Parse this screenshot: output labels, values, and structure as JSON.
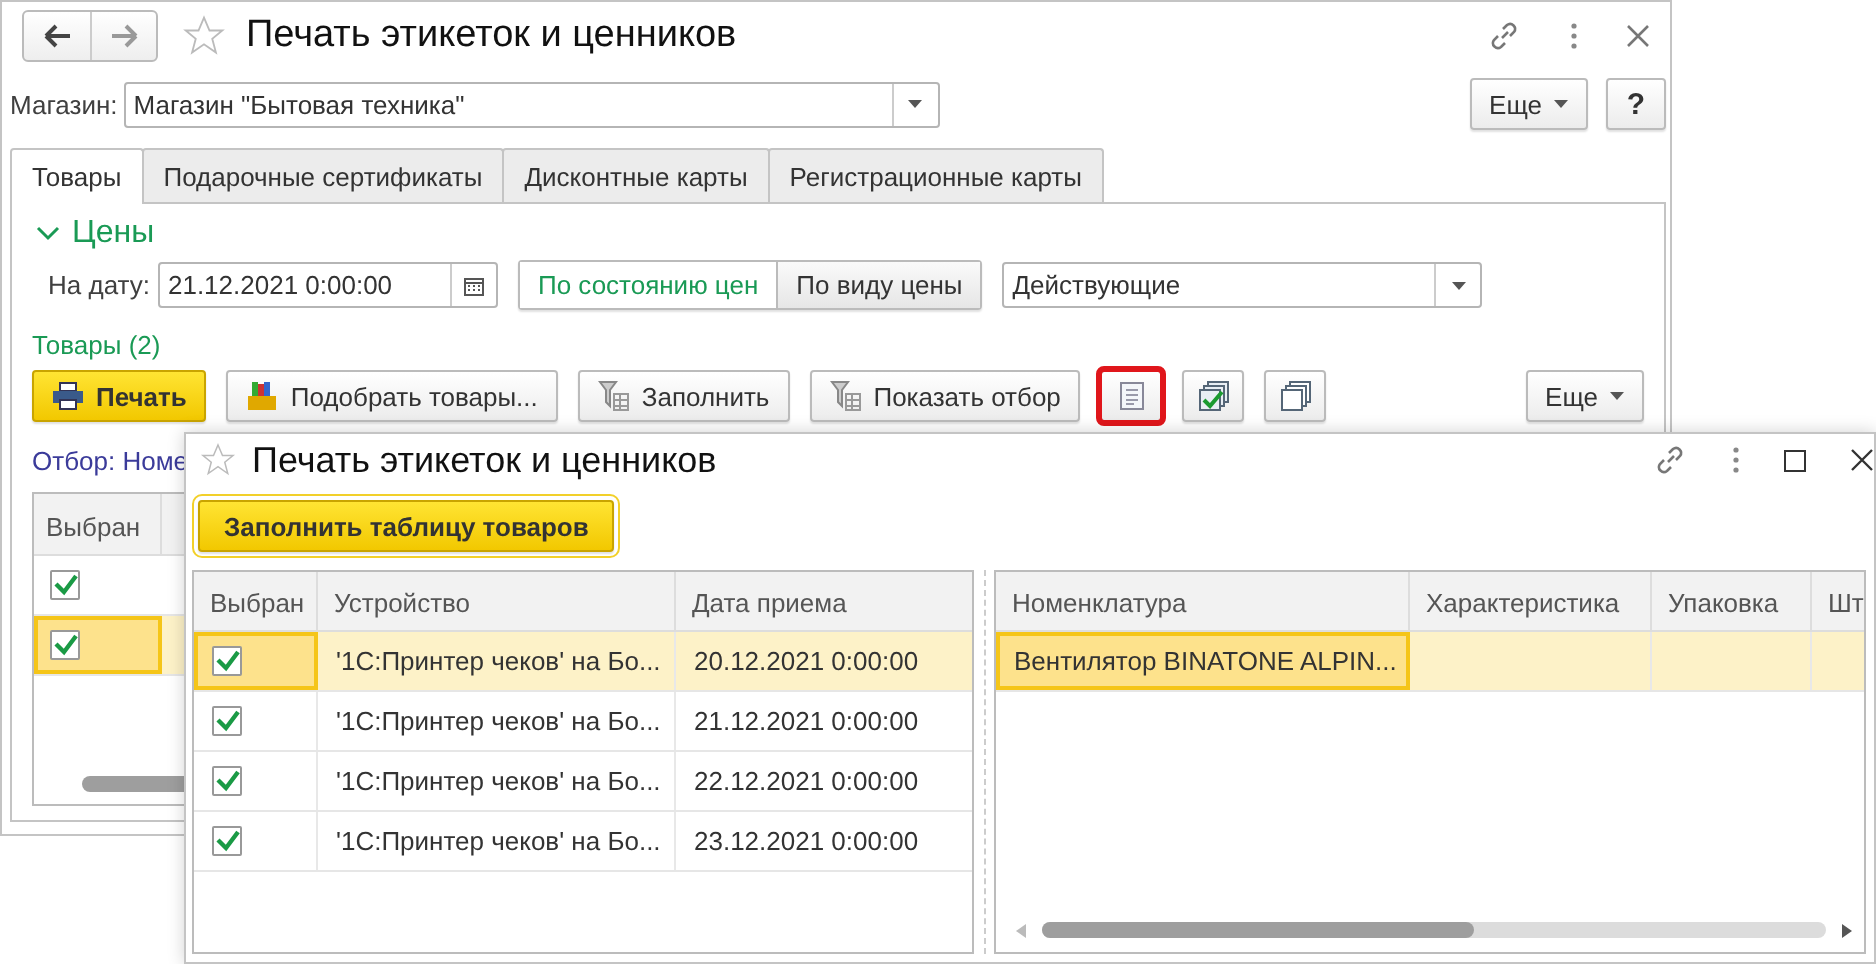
{
  "main_window": {
    "title": "Печать этикеток и ценников",
    "store_label": "Магазин:",
    "store_value": "Магазин \"Бытовая техника\"",
    "more_button": "Еще",
    "help_button": "?",
    "tabs": [
      {
        "label": "Товары",
        "selected": true
      },
      {
        "label": "Подарочные сертификаты",
        "selected": false
      },
      {
        "label": "Дисконтные карты",
        "selected": false
      },
      {
        "label": "Регистрационные карты",
        "selected": false
      }
    ],
    "prices": {
      "title": "Цены",
      "expanded": true,
      "date_label": "На дату:",
      "date_value": "21.12.2021  0:00:00",
      "modes": [
        {
          "label": "По состоянию цен",
          "selected": true
        },
        {
          "label": "По виду цены",
          "selected": false
        }
      ],
      "price_kind": "Действующие"
    },
    "goods_title": "Товары (2)",
    "toolbar": [
      {
        "kind": "primary",
        "label": "Печать",
        "highlighted": false
      },
      {
        "kind": "text",
        "label": "Подобрать товары...",
        "highlighted": false
      },
      {
        "kind": "text",
        "label": "Заполнить",
        "highlighted": false
      },
      {
        "kind": "text",
        "label": "Показать отбор",
        "highlighted": false
      },
      {
        "kind": "icon",
        "highlighted": true
      },
      {
        "kind": "icon",
        "highlighted": false
      },
      {
        "kind": "icon",
        "highlighted": false
      },
      {
        "kind": "more",
        "label": "Еще",
        "highlighted": false
      }
    ],
    "filter_text": "Отбор: Номе",
    "table": {
      "columns": [
        "Выбран"
      ],
      "rows": [
        {
          "checked": true,
          "selected": false
        },
        {
          "checked": true,
          "selected": true
        }
      ]
    }
  },
  "dialog": {
    "title": "Печать этикеток и ценников",
    "fill_button": "Заполнить таблицу товаров",
    "devices": {
      "columns": [
        "Выбран",
        "Устройство",
        "Дата приема"
      ],
      "rows": [
        {
          "checked": true,
          "device": "'1С:Принтер чеков' на Бо...",
          "date": "20.12.2021 0:00:00",
          "selected": true
        },
        {
          "checked": true,
          "device": "'1С:Принтер чеков' на Бо...",
          "date": "21.12.2021 0:00:00",
          "selected": false
        },
        {
          "checked": true,
          "device": "'1С:Принтер чеков' на Бо...",
          "date": "22.12.2021 0:00:00",
          "selected": false
        },
        {
          "checked": true,
          "device": "'1С:Принтер чеков' на Бо...",
          "date": "23.12.2021 0:00:00",
          "selected": false
        }
      ]
    },
    "goods": {
      "columns": [
        "Номенклатура",
        "Характеристика",
        "Упаковка",
        "Шт"
      ],
      "rows": [
        {
          "nomenclature": "Вентилятор BINATONE ALPIN...",
          "selected": true
        }
      ]
    }
  }
}
